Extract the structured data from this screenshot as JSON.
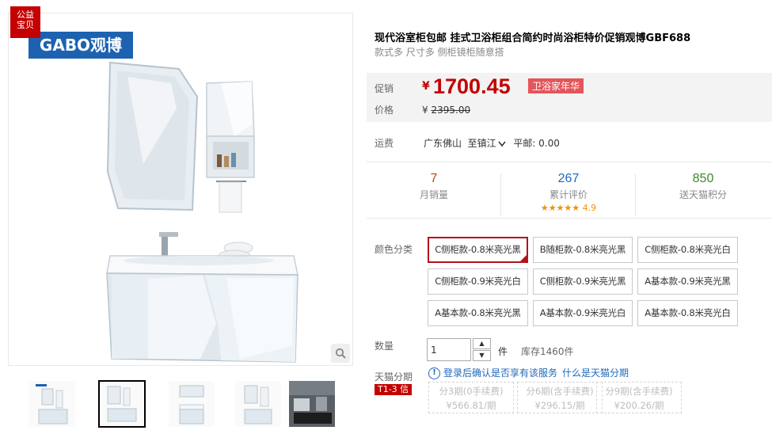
{
  "gallery": {
    "badge_line1": "公益",
    "badge_line2": "宝贝",
    "logo_latin": "GABO",
    "logo_cn": "观博"
  },
  "product": {
    "title": "现代浴室柜包邮 挂式卫浴柜组合简约时尚浴柜特价促销观博GBF688",
    "subtitle": "款式多 尺寸多 侧柜镜柜随意搭"
  },
  "price": {
    "promo_label": "促销",
    "currency": "¥",
    "promo_value": "1700.45",
    "promo_tag": "卫浴家年华",
    "orig_label": "价格",
    "orig_value": "2395.00"
  },
  "shipping": {
    "label": "运费",
    "origin": "广东佛山",
    "destination": "至镇江",
    "method": "平邮: 0.00"
  },
  "stats": {
    "monthly_sales": "7",
    "monthly_sales_label": "月销量",
    "reviews": "267",
    "reviews_label": "累计评价",
    "stars": "★★★★★",
    "rating": "4.9",
    "points": "850",
    "points_label": "送天猫积分"
  },
  "colors": {
    "label": "颜色分类",
    "options": [
      "C侧柜款-0.8米亮光黑",
      "B随柜款-0.8米亮光黑",
      "C侧柜款-0.8米亮光白",
      "C侧柜款-0.9米亮光白",
      "C侧柜款-0.9米亮光黑",
      "A基本款-0.9米亮光黑",
      "A基本款-0.8米亮光黑",
      "A基本款-0.9米亮光白",
      "A基本款-0.8米亮光白"
    ],
    "selected_color": "#b3131a"
  },
  "quantity": {
    "label": "数量",
    "value": "1",
    "unit": "件",
    "stock": "库存1460件"
  },
  "installment": {
    "label": "天猫分期",
    "tag": "T1-3 信",
    "note": "登录后确认是否享有该服务",
    "link": "什么是天猫分期",
    "plans": [
      {
        "term": "分3期(0手续费)",
        "amount": "¥566.81/期"
      },
      {
        "term": "分6期(含手续费)",
        "amount": "¥296.15/期"
      },
      {
        "term": "分9期(含手续费)",
        "amount": "¥200.26/期"
      }
    ]
  },
  "icons": {
    "zoom": "magnifier-icon",
    "info": "info-icon",
    "dropdown": "chevron-down-icon"
  }
}
